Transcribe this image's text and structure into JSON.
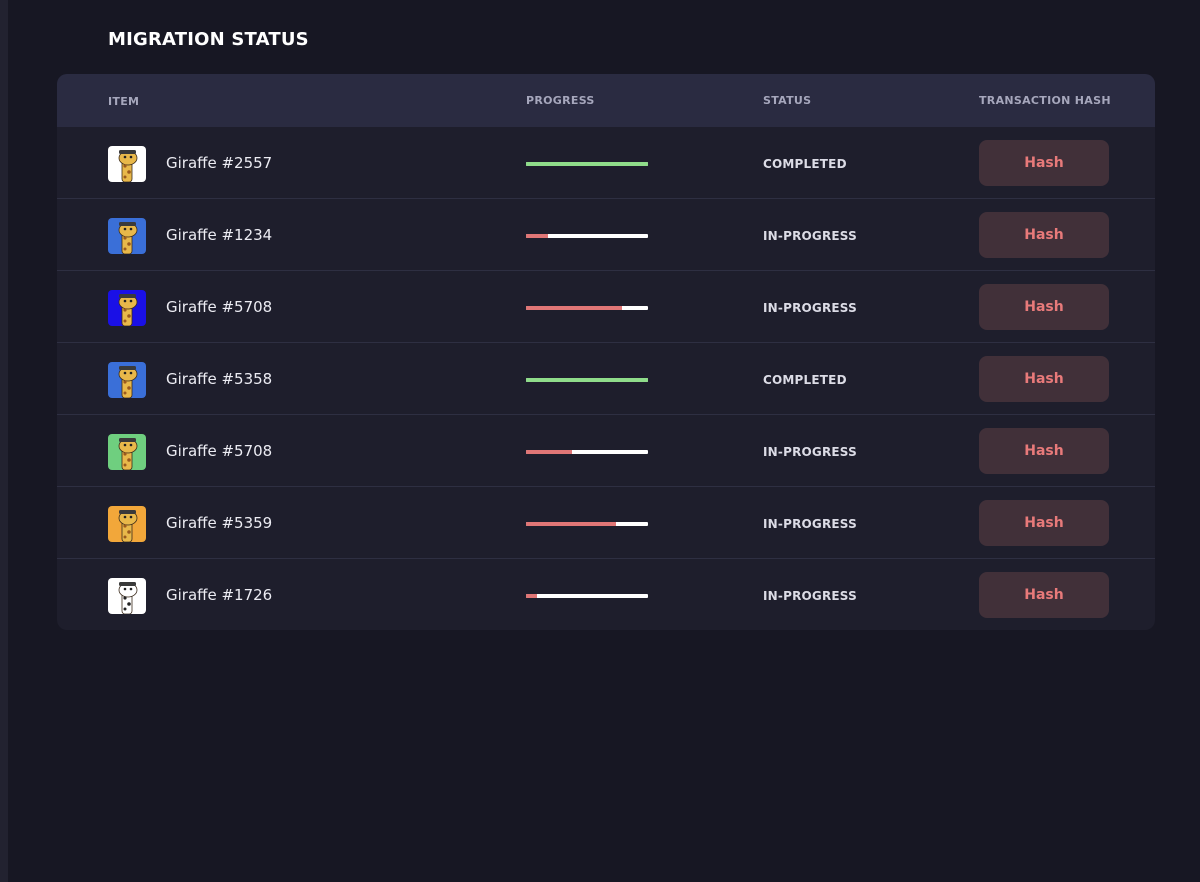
{
  "page": {
    "title": "MIGRATION STATUS"
  },
  "table": {
    "headers": {
      "item": "ITEM",
      "progress": "PROGRESS",
      "status": "STATUS",
      "hash": "TRANSACTION HASH"
    },
    "rows": [
      {
        "name": "Giraffe #2557",
        "progress": 1.0,
        "status": "COMPLETED",
        "button": "Hash",
        "avatar_bg": "#ffffff",
        "avatar_icon": "giraffe-avatar-icon"
      },
      {
        "name": "Giraffe #1234",
        "progress": 0.18,
        "status": "IN-PROGRESS",
        "button": "Hash",
        "avatar_bg": "#3a6fd8",
        "avatar_icon": "giraffe-avatar-icon"
      },
      {
        "name": "Giraffe #5708",
        "progress": 0.79,
        "status": "IN-PROGRESS",
        "button": "Hash",
        "avatar_bg": "#1a10e6",
        "avatar_icon": "giraffe-avatar-icon"
      },
      {
        "name": "Giraffe #5358",
        "progress": 1.0,
        "status": "COMPLETED",
        "button": "Hash",
        "avatar_bg": "#3a6fd8",
        "avatar_icon": "giraffe-avatar-icon"
      },
      {
        "name": "Giraffe #5708",
        "progress": 0.38,
        "status": "IN-PROGRESS",
        "button": "Hash",
        "avatar_bg": "#6fcf7f",
        "avatar_icon": "giraffe-avatar-icon"
      },
      {
        "name": "Giraffe #5359",
        "progress": 0.74,
        "status": "IN-PROGRESS",
        "button": "Hash",
        "avatar_bg": "#f2a73a",
        "avatar_icon": "giraffe-avatar-icon"
      },
      {
        "name": "Giraffe #1726",
        "progress": 0.09,
        "status": "IN-PROGRESS",
        "button": "Hash",
        "avatar_bg": "#ffffff",
        "avatar_icon": "zebra-avatar-icon"
      }
    ]
  },
  "colors": {
    "progress_complete": "#8fdc8a",
    "progress_partial": "#e07676",
    "hash_button_bg": "#413039",
    "hash_button_text": "#e87a7a"
  }
}
